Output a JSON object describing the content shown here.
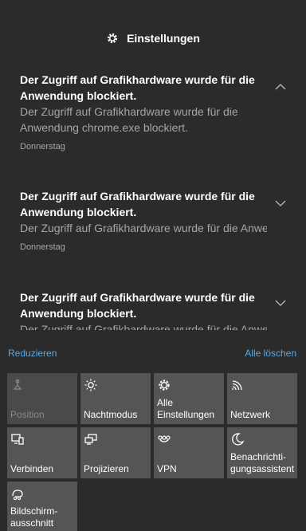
{
  "header": {
    "title": "Einstellungen",
    "icon": "gear-icon"
  },
  "notifications": [
    {
      "title": "Der Zugriff auf Grafikhardware wurde für die Anwendung blockiert.",
      "body": "Der Zugriff auf Grafikhardware wurde für die Anwendung chrome.exe blockiert.",
      "time": "Donnerstag",
      "expanded": true
    },
    {
      "title": "Der Zugriff auf Grafikhardware wurde für die Anwendung blockiert.",
      "body": "Der Zugriff auf Grafikhardware wurde für die Anwendung chrome.exe blockiert.",
      "time": "Donnerstag",
      "expanded": false
    },
    {
      "title": "Der Zugriff auf Grafikhardware wurde für die Anwendung blockiert.",
      "body": "Der Zugriff auf Grafikhardware wurde für die Anwendung chrome.exe blockiert.",
      "expanded": false
    }
  ],
  "actions": {
    "collapse": "Reduzieren",
    "clear_all": "Alle löschen"
  },
  "tiles": [
    {
      "label": "Position",
      "icon": "location-icon",
      "disabled": true
    },
    {
      "label": "Nachtmodus",
      "icon": "brightness-icon",
      "disabled": false
    },
    {
      "label": "Alle Einstellungen",
      "icon": "gear-icon",
      "disabled": false
    },
    {
      "label": "Netzwerk",
      "icon": "network-icon",
      "disabled": false
    },
    {
      "label": "Verbinden",
      "icon": "connect-icon",
      "disabled": false
    },
    {
      "label": "Projizieren",
      "icon": "project-icon",
      "disabled": false
    },
    {
      "label": "VPN",
      "icon": "vpn-icon",
      "disabled": false
    },
    {
      "label": "Benachrichti-gungsassistent",
      "icon": "moon-icon",
      "disabled": false
    },
    {
      "label": "Bildschirm-ausschnitt",
      "icon": "snip-icon",
      "disabled": false
    }
  ],
  "colors": {
    "background": "#2b2b2b",
    "tile": "#555555",
    "accent": "#5aa9e6",
    "secondary_text": "#a6a6a6"
  }
}
